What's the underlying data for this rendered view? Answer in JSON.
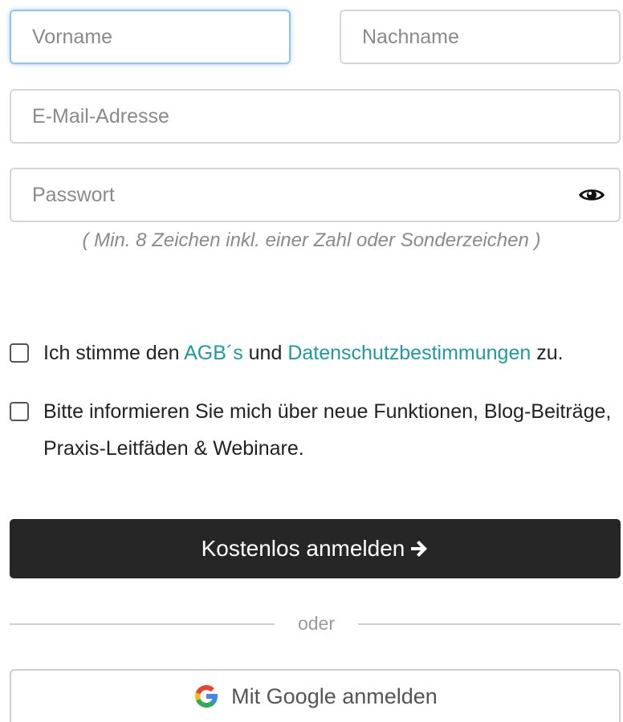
{
  "form": {
    "first_name": {
      "placeholder": "Vorname",
      "value": ""
    },
    "last_name": {
      "placeholder": "Nachname",
      "value": ""
    },
    "email": {
      "placeholder": "E-Mail-Adresse",
      "value": ""
    },
    "password": {
      "placeholder": "Passwort",
      "value": "",
      "toggle_icon": "eye-icon"
    },
    "password_hint": "( Min. 8 Zeichen inkl. einer Zahl oder Sonderzeichen )"
  },
  "consent": {
    "agb": {
      "checked": false,
      "text_before": "Ich stimme den ",
      "link_agb": "AGB´s",
      "text_middle": " und ",
      "link_privacy": "Datenschutzbestimmungen",
      "text_after": " zu."
    },
    "newsletter": {
      "checked": false,
      "text": "Bitte informieren Sie mich über neue Funktionen, Blog-Beiträge, Praxis-Leitfäden & Webinare."
    }
  },
  "actions": {
    "submit_label": "Kostenlos anmelden",
    "submit_icon": "arrow-right-icon",
    "divider_text": "oder",
    "google_label": "Mit Google anmelden",
    "google_icon": "google-logo-icon"
  },
  "colors": {
    "link": "#1e9aa0",
    "primary_button": "#262626",
    "focus_border": "#90c2f0"
  }
}
